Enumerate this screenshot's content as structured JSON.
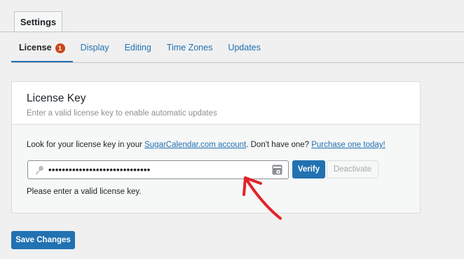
{
  "top_tab": {
    "label": "Settings"
  },
  "subnav": {
    "items": [
      {
        "label": "License",
        "badge": "1"
      },
      {
        "label": "Display"
      },
      {
        "label": "Editing"
      },
      {
        "label": "Time Zones"
      },
      {
        "label": "Updates"
      }
    ]
  },
  "license": {
    "title": "License Key",
    "description": "Enter a valid license key to enable automatic updates",
    "hint_prefix": "Look for your license key in your ",
    "hint_link1": "SugarCalendar.com account",
    "hint_middle": ". Don't have one? ",
    "hint_link2": "Purchase one today!",
    "key_value": "••••••••••••••••••••••••••••••",
    "verify_label": "Verify",
    "deactivate_label": "Deactivate",
    "error": "Please enter a valid license key."
  },
  "footer": {
    "save_label": "Save Changes"
  },
  "colors": {
    "accent": "#2271b1",
    "badge": "#c9461c",
    "annotation": "#e0242a"
  },
  "icons": {
    "key": "key-icon",
    "password_manager": "password-manager-icon"
  }
}
